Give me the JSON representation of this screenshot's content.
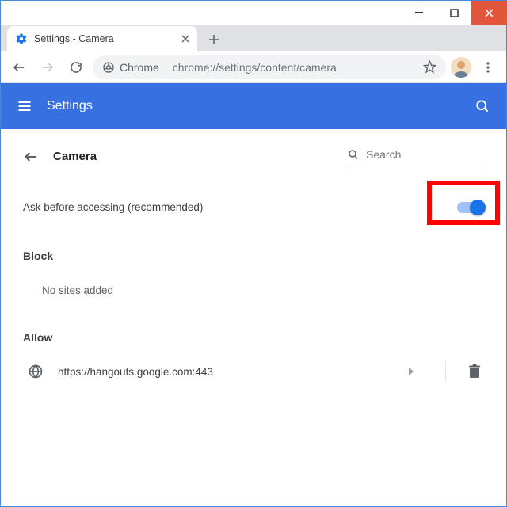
{
  "window": {
    "tab_title": "Settings - Camera",
    "url": "chrome://settings/content/camera",
    "chrome_chip": "Chrome"
  },
  "bluebar": {
    "title": "Settings"
  },
  "page": {
    "back_label": "Camera",
    "search_placeholder": "Search",
    "ask_label": "Ask before accessing (recommended)",
    "toggle_on": true,
    "block_title": "Block",
    "block_empty": "No sites added",
    "allow_title": "Allow",
    "allow_items": [
      {
        "site": "https://hangouts.google.com:443"
      }
    ]
  }
}
